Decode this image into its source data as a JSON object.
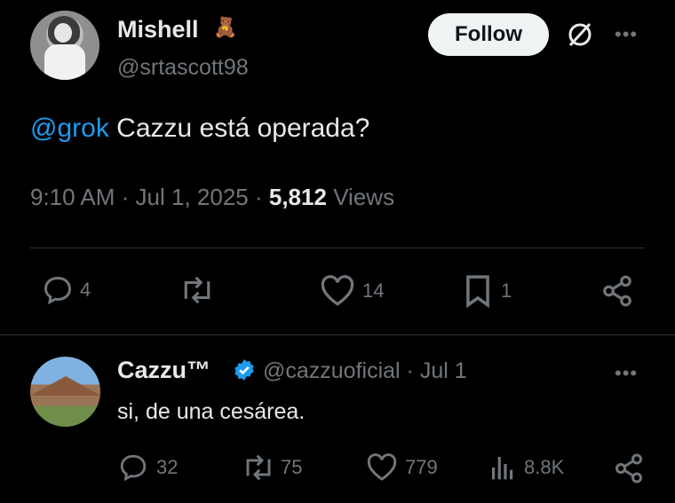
{
  "tweet": {
    "author_name": "Mishell",
    "author_emoji": "🧸",
    "author_handle": "@srtascott98",
    "follow_label": "Follow",
    "mention": "@grok",
    "text": " Cazzu está operada?",
    "time": "9:10 AM",
    "date": "Jul 1, 2025",
    "views_count": "5,812",
    "views_label": "Views",
    "reply_count": "4",
    "bookmark_count": "14",
    "save_count": "1"
  },
  "reply": {
    "author_name": "Cazzu™",
    "author_handle": "@cazzuoficial · Jul 1",
    "text": "si, de una cesárea.",
    "reply_count": "32",
    "repost_count": "75",
    "like_count": "779",
    "views_count": "8.8K"
  },
  "colors": {
    "background": "#000000",
    "text": "#e7e9ea",
    "muted": "#71767b",
    "accent": "#1d9bf0",
    "follow_bg": "#eff3f4"
  },
  "icons": {
    "reply": "reply-icon",
    "repost": "repost-icon",
    "like": "heart-icon",
    "bookmark": "bookmark-icon",
    "share": "share-icon",
    "views": "views-icon",
    "grok": "grok-icon",
    "more": "more-icon",
    "verified": "verified-icon"
  }
}
